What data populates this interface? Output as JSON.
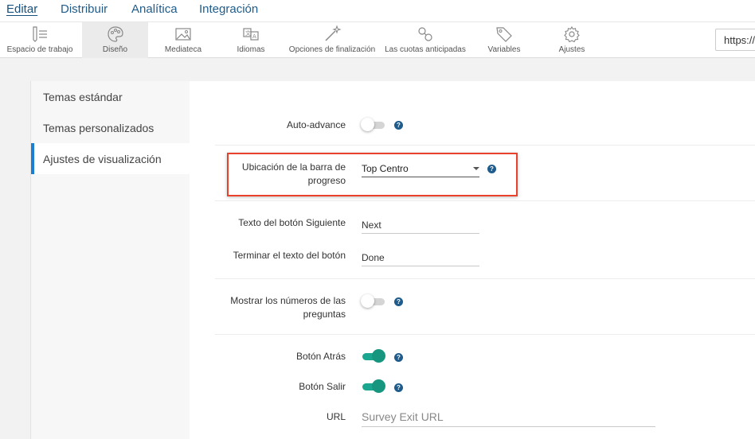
{
  "topnav": {
    "items": [
      {
        "label": "Editar",
        "active": true
      },
      {
        "label": "Distribuir",
        "active": false
      },
      {
        "label": "Analítica",
        "active": false
      },
      {
        "label": "Integración",
        "active": false
      }
    ]
  },
  "toolbar": {
    "tools": [
      {
        "label": "Espacio de trabajo",
        "icon": "workspace-icon",
        "active": false
      },
      {
        "label": "Diseño",
        "icon": "palette-icon",
        "active": true
      },
      {
        "label": "Mediateca",
        "icon": "image-icon",
        "active": false
      },
      {
        "label": "Idiomas",
        "icon": "language-icon",
        "active": false
      },
      {
        "label": "Opciones de finalización",
        "icon": "magic-wand-icon",
        "active": false
      },
      {
        "label": "Las cuotas anticipadas",
        "icon": "quota-icon",
        "active": false
      },
      {
        "label": "Variables",
        "icon": "tag-icon",
        "active": false
      },
      {
        "label": "Ajustes",
        "icon": "gear-icon",
        "active": false
      }
    ],
    "url_text": "https://"
  },
  "sidebar": {
    "items": [
      {
        "label": "Temas estándar",
        "active": false
      },
      {
        "label": "Temas personalizados",
        "active": false
      },
      {
        "label": "Ajustes de visualización",
        "active": true
      }
    ]
  },
  "settings": {
    "auto_advance": {
      "label": "Auto-advance",
      "enabled": false
    },
    "progress_bar": {
      "label_line1": "Ubicación de la barra de",
      "label_line2": "progreso",
      "value": "Top Centro"
    },
    "next_button": {
      "label": "Texto del botón Siguiente",
      "value": "Next"
    },
    "finish_button": {
      "label": "Terminar el texto del botón",
      "value": "Done"
    },
    "question_numbers": {
      "label_line1": "Mostrar los números de las",
      "label_line2": "preguntas",
      "enabled": false
    },
    "back_button": {
      "label": "Botón Atrás",
      "enabled": true
    },
    "exit_button": {
      "label": "Botón Salir",
      "enabled": true
    },
    "url": {
      "label": "URL",
      "placeholder": "Survey Exit URL"
    }
  },
  "help_glyph": "?",
  "colors": {
    "accent": "#1a7fd1",
    "toggle_on": "#1aa68f",
    "highlight": "#e8412c",
    "nav_text": "#1f5c8b"
  }
}
